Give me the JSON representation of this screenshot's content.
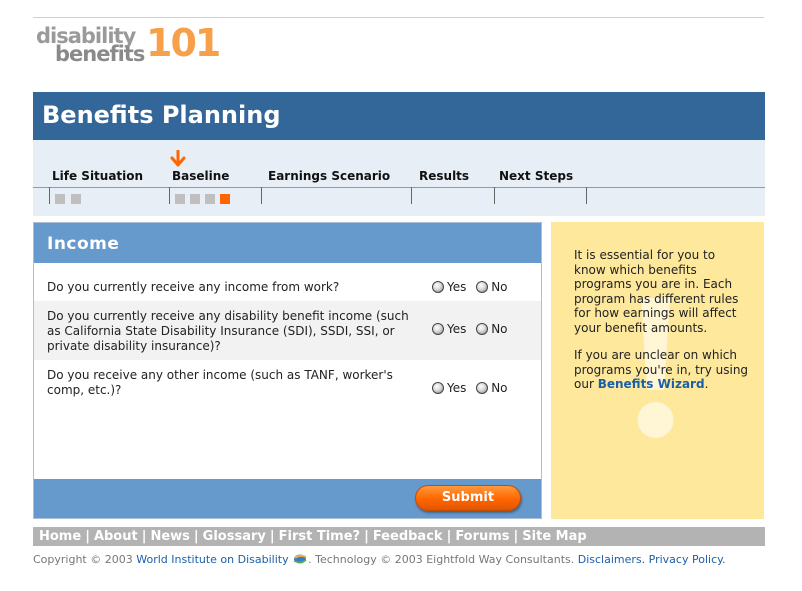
{
  "logo": {
    "line1": "disability",
    "line2": "benefits",
    "number": "101"
  },
  "header": {
    "title": "Benefits Planning"
  },
  "steps": {
    "items": [
      {
        "label": "Life Situation"
      },
      {
        "label": "Baseline"
      },
      {
        "label": "Earnings Scenario"
      },
      {
        "label": "Results"
      },
      {
        "label": "Next Steps"
      }
    ],
    "current": "Baseline",
    "progress_done": 3,
    "progress_total": 6
  },
  "form": {
    "title": "Income",
    "questions": [
      {
        "text": "Do you currently receive any income from work?",
        "yes": "Yes",
        "no": "No"
      },
      {
        "text": "Do you currently receive any disability benefit income (such as California State Disability Insurance (SDI), SSDI, SSI, or private disability insurance)?",
        "yes": "Yes",
        "no": "No"
      },
      {
        "text": "Do you receive any other income (such as TANF, worker's comp, etc.)?",
        "yes": "Yes",
        "no": "No"
      }
    ],
    "submit_label": "Submit"
  },
  "info": {
    "para1": "It is essential for you to know which  benefits programs you are in. Each program has different rules for how earnings will affect your benefit amounts.",
    "para2_prefix": "If you are unclear on which programs you're in, try using our ",
    "para2_link": "Benefits Wizard",
    "para2_suffix": "."
  },
  "footer": {
    "links": [
      "Home",
      "About",
      "News",
      "Glossary",
      "First Time?",
      "Feedback",
      "Forums",
      "Site Map"
    ],
    "copyright_prefix": "Copyright © 2003 ",
    "org_link": "World Institute on Disability",
    "tech_text": ".  Technology © 2003 Eightfold Way Consultants.  ",
    "disclaimers": "Disclaimers.",
    "privacy": "Privacy Policy."
  },
  "colors": {
    "header_blue": "#336699",
    "panel_blue": "#6699cc",
    "accent_orange": "#ff6600",
    "info_yellow": "#fde89c",
    "link_blue": "#1a5fa8"
  }
}
